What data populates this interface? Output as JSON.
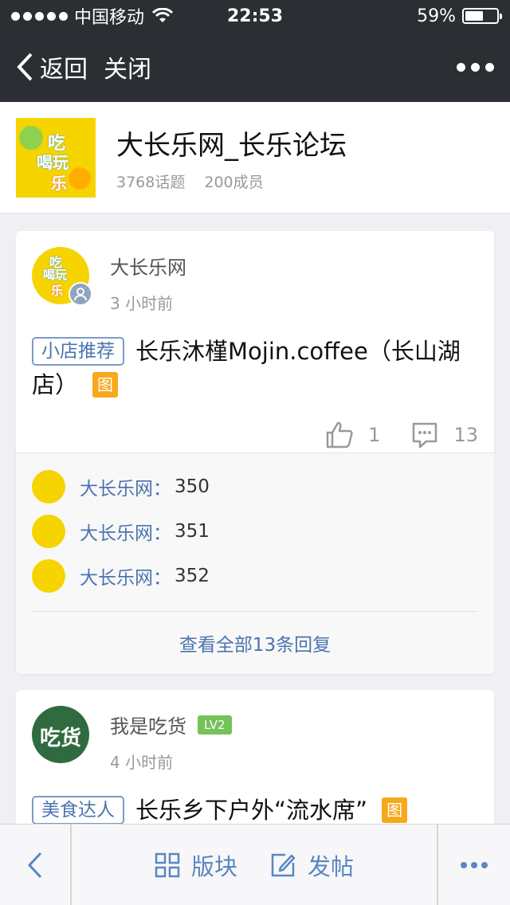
{
  "status_bar": {
    "carrier": "中国移动",
    "time": "22:53",
    "battery": "59%",
    "battery_level": 0.59
  },
  "nav": {
    "back_label": "返回",
    "close_label": "关闭"
  },
  "forum": {
    "title": "大长乐网_长乐论坛",
    "topics": "3768话题",
    "members": "200成员",
    "logo_text": [
      "吃",
      "喝玩",
      "乐"
    ]
  },
  "posts": [
    {
      "author": "大长乐网",
      "time": "3 小时前",
      "tag": "小店推荐",
      "title": "长乐沐槿Mojin.coffee（长山湖店）",
      "image_badge": "图",
      "likes": "1",
      "comments": "13",
      "replies": [
        {
          "author": "大长乐网：",
          "text": "350"
        },
        {
          "author": "大长乐网：",
          "text": "351"
        },
        {
          "author": "大长乐网：",
          "text": "352"
        }
      ],
      "view_all": "查看全部13条回复"
    },
    {
      "author": "我是吃货",
      "level": "LV2",
      "time": "4 小时前",
      "tag": "美食达人",
      "title": "长乐乡下户外“流水席”",
      "image_badge": "图",
      "avatar_text": "吃货"
    }
  ],
  "toolbar": {
    "sections_label": "版块",
    "post_label": "发帖"
  },
  "colors": {
    "accent": "#4b74b0",
    "nav_bg": "#2b2e33",
    "image_badge": "#f7a81b",
    "level_badge": "#74c25a"
  }
}
